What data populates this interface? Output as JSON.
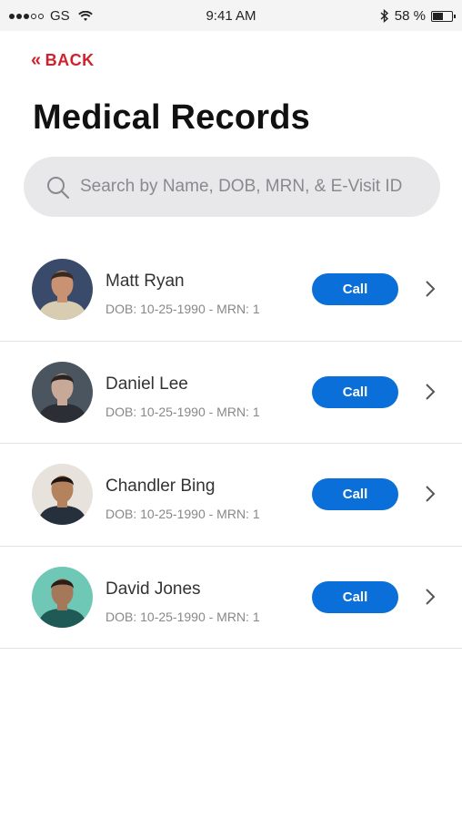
{
  "status_bar": {
    "carrier": "GS",
    "time": "9:41 AM",
    "battery_text": "58 %",
    "battery_level": 0.58,
    "signal_bars_filled": 3,
    "signal_bars_total": 5
  },
  "nav": {
    "back_label": "BACK",
    "back_icon": "«"
  },
  "page": {
    "title": "Medical Records"
  },
  "search": {
    "placeholder": "Search by Name, DOB, MRN, & E-Visit ID"
  },
  "patients": [
    {
      "name": "Matt Ryan",
      "meta": "DOB: 10-25-1990 - MRN: 1",
      "call_label": "Call",
      "avatar_bg": "#3a4a6a",
      "skin": "#c99273",
      "hair": "#3a2a1e",
      "shirt": "#d8cdb0"
    },
    {
      "name": "Daniel Lee",
      "meta": "DOB: 10-25-1990 - MRN: 1",
      "call_label": "Call",
      "avatar_bg": "#4a5560",
      "skin": "#c8a896",
      "hair": "#2a2420",
      "shirt": "#2b2f35"
    },
    {
      "name": "Chandler Bing",
      "meta": "DOB: 10-25-1990 - MRN: 1",
      "call_label": "Call",
      "avatar_bg": "#e8e2dc",
      "skin": "#b5825e",
      "hair": "#1e1612",
      "shirt": "#26303c"
    },
    {
      "name": "David Jones",
      "meta": "DOB: 10-25-1990 - MRN: 1",
      "call_label": "Call",
      "avatar_bg": "#6fc7b5",
      "skin": "#a5785a",
      "hair": "#2a1f18",
      "shirt": "#1f5a56"
    }
  ],
  "colors": {
    "accent_red": "#d0222d",
    "call_blue": "#0a6fd8",
    "search_bg": "#e8e8ea"
  }
}
